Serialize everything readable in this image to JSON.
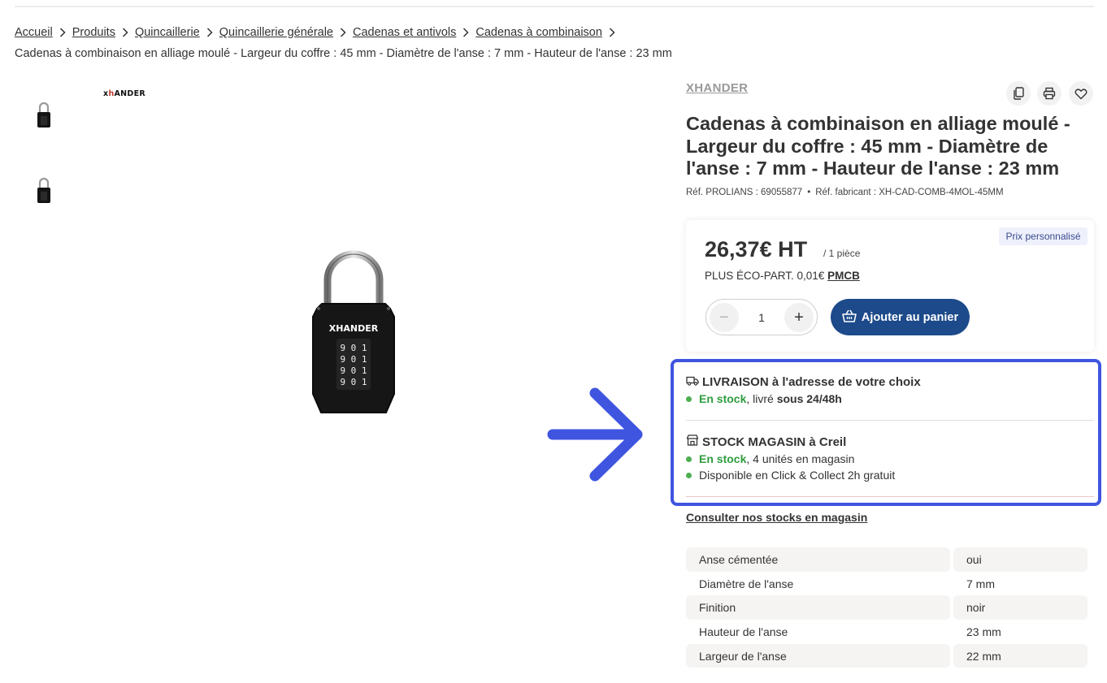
{
  "breadcrumb": {
    "items": [
      "Accueil",
      "Produits",
      "Quincaillerie",
      "Quincaillerie générale",
      "Cadenas et antivols",
      "Cadenas à combinaison"
    ],
    "current": "Cadenas à combinaison en alliage moulé - Largeur du coffre : 45 mm - Diamètre de l'anse : 7 mm - Hauteur de l'anse : 23 mm"
  },
  "gallery": {
    "brand_logo_text": "XHANDER",
    "padlock_logo_text": "XHANDER",
    "dial_digits": [
      "9 0 1",
      "9 0 1",
      "9 0 1",
      "9 0 1"
    ]
  },
  "product": {
    "brand": "XHANDER",
    "title": "Cadenas à combinaison en alliage moulé - Largeur du coffre : 45 mm - Diamètre de l'anse : 7 mm - Hauteur de l'anse : 23 mm",
    "ref_prolians": "Réf. PROLIANS : 69055877",
    "ref_fabricant": "Réf. fabricant : XH-CAD-COMB-4MOL-45MM",
    "ref_separator": "•"
  },
  "pricing": {
    "badge": "Prix personnalisé",
    "price": "26,37€ HT",
    "unit": "/ 1 pièce",
    "ecopart_label": "PLUS ÉCO-PART. 0,01€",
    "ecopart_link": "PMCB",
    "quantity": "1",
    "minus": "−",
    "plus": "+",
    "add_to_cart": "Ajouter au panier"
  },
  "availability": {
    "delivery_title": "LIVRAISON à l'adresse de votre choix",
    "delivery_status": "En stock",
    "delivery_text": ", livré ",
    "delivery_time": "sous 24/48h",
    "store_title": "STOCK MAGASIN à Creil",
    "store_status": "En stock",
    "store_text": ", 4 unités en magasin",
    "click_collect": "Disponible en Click & Collect 2h gratuit",
    "stock_link": "Consulter nos stocks en magasin"
  },
  "specs": [
    {
      "label": "Anse cémentée",
      "value": "oui"
    },
    {
      "label": "Diamètre de l'anse",
      "value": "7 mm"
    },
    {
      "label": "Finition",
      "value": "noir"
    },
    {
      "label": "Hauteur de l'anse",
      "value": "23 mm"
    },
    {
      "label": "Largeur de l'anse",
      "value": "22 mm"
    }
  ],
  "colors": {
    "primary_button": "#1c4a8a",
    "highlight_border": "#3f55e0",
    "in_stock_green": "#2e9d3f",
    "annotation_arrow": "#3f55e0"
  },
  "icons": [
    "chevron-right-icon",
    "copy-icon",
    "print-icon",
    "heart-icon",
    "basket-icon",
    "truck-icon",
    "store-icon",
    "arrow-right-icon"
  ]
}
